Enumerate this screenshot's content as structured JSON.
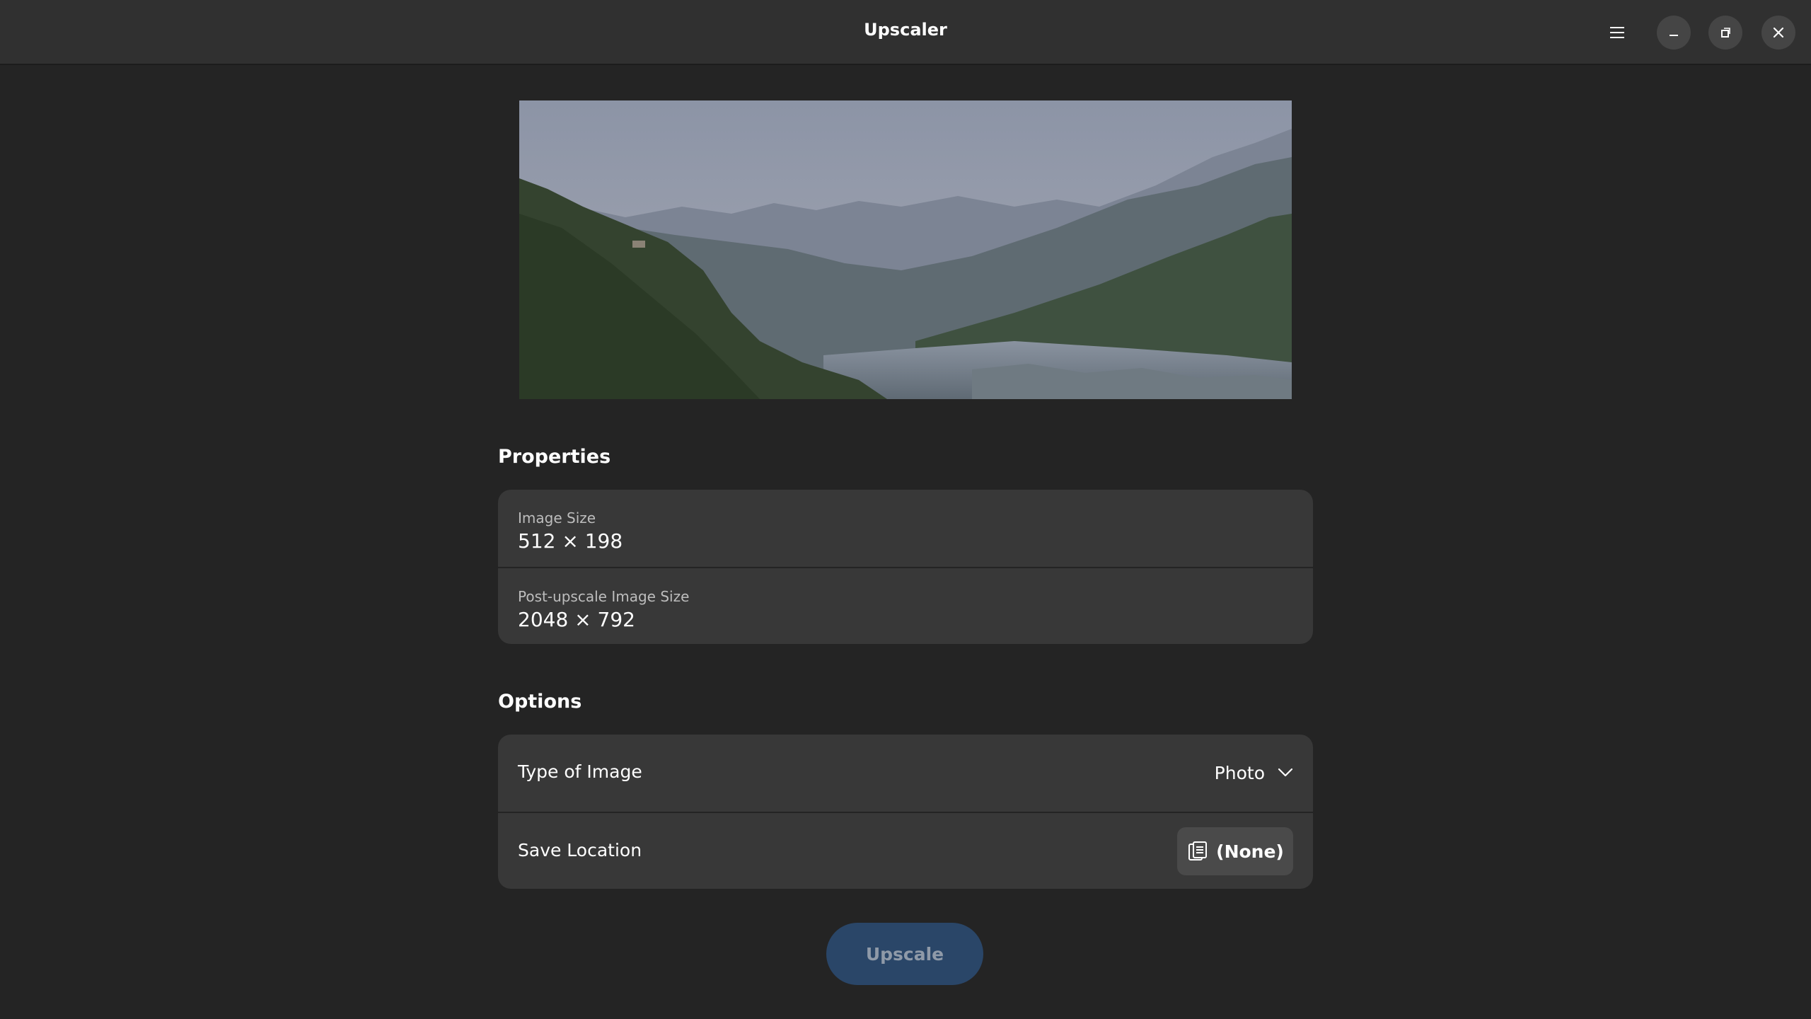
{
  "window": {
    "title": "Upscaler"
  },
  "header_buttons": {
    "menu_icon": "hamburger-menu-icon",
    "minimize_icon": "minimize-icon",
    "maximize_icon": "restore-icon",
    "close_icon": "close-icon"
  },
  "properties": {
    "heading": "Properties",
    "image_size_label": "Image Size",
    "image_size_value": "512 × 198",
    "post_size_label": "Post-upscale Image Size",
    "post_size_value": "2048 × 792"
  },
  "options": {
    "heading": "Options",
    "type_label": "Type of Image",
    "type_value": "Photo",
    "save_label": "Save Location",
    "save_value": "(None)"
  },
  "actions": {
    "upscale_label": "Upscale"
  },
  "colors": {
    "background": "#242424",
    "headerbar": "#303030",
    "card": "#383838",
    "accent_disabled": "#2a4668"
  }
}
